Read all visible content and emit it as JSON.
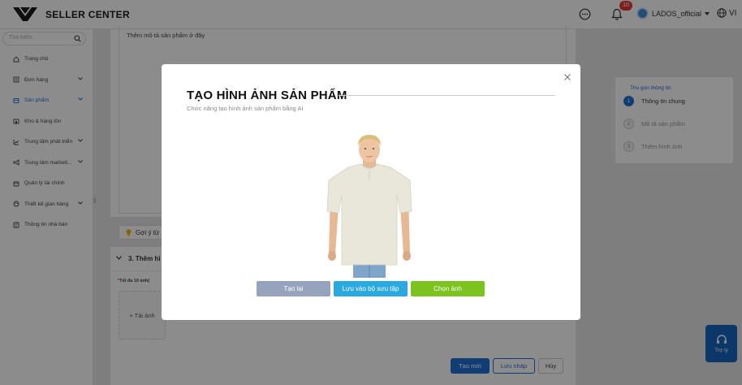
{
  "header": {
    "brand": "SELLER CENTER",
    "notifications_count": "10",
    "username": "LADOS_official",
    "language": "VI"
  },
  "sidebar": {
    "search_placeholder": "Tìm kiếm",
    "items": [
      {
        "label": "Trang chủ",
        "icon": "home-icon",
        "chevron": false
      },
      {
        "label": "Đơn hàng",
        "icon": "orders-icon",
        "chevron": true
      },
      {
        "label": "Sản phẩm",
        "icon": "product-icon",
        "chevron": true,
        "active": true
      },
      {
        "label": "Kho & hàng tồn",
        "icon": "warehouse-icon",
        "chevron": false
      },
      {
        "label": "Trung tâm phát triển",
        "icon": "growth-icon",
        "chevron": true
      },
      {
        "label": "Trung tâm marketi...",
        "icon": "marketing-icon",
        "chevron": true
      },
      {
        "label": "Quản lý tài chính",
        "icon": "finance-icon",
        "chevron": false
      },
      {
        "label": "Thiết kế gian hàng",
        "icon": "design-icon",
        "chevron": true
      },
      {
        "label": "Thông tin nhà bán",
        "icon": "seller-info-icon",
        "chevron": false
      }
    ]
  },
  "main": {
    "description_placeholder": "Thêm mô tả sản phẩm ở đây",
    "suggest_label": "Gợi ý từ",
    "section3_title": "3. Thêm hì",
    "image_note": "Tối đa 10 ảnh(",
    "upload_label": "+ Tải ảnh",
    "buttons": {
      "create": "Tạo mới",
      "draft": "Lưu nháp",
      "cancel": "Hủy"
    }
  },
  "steps_panel": {
    "title": "Thu gọn thông tin",
    "steps": [
      {
        "num": "1",
        "label": "Thông tin chung",
        "active": true
      },
      {
        "num": "2",
        "label": "Mô tả sản phẩm",
        "active": false
      },
      {
        "num": "3",
        "label": "Thêm hình ảnh",
        "active": false
      }
    ]
  },
  "help": {
    "label": "Trợ lý"
  },
  "modal": {
    "title": "TẠO HÌNH ẢNH SẢN PHẨM",
    "subtitle": "Chức năng tạo hình ảnh sản phẩm bằng AI",
    "buttons": {
      "retry": "Tạo lại",
      "save_collection": "Lưu vào bộ sưu tập",
      "choose": "Chọn ảnh"
    }
  },
  "colors": {
    "accent": "#1f6fd6",
    "retry": "#97a3bd",
    "save": "#2aa8e0",
    "choose": "#7cc31f"
  }
}
